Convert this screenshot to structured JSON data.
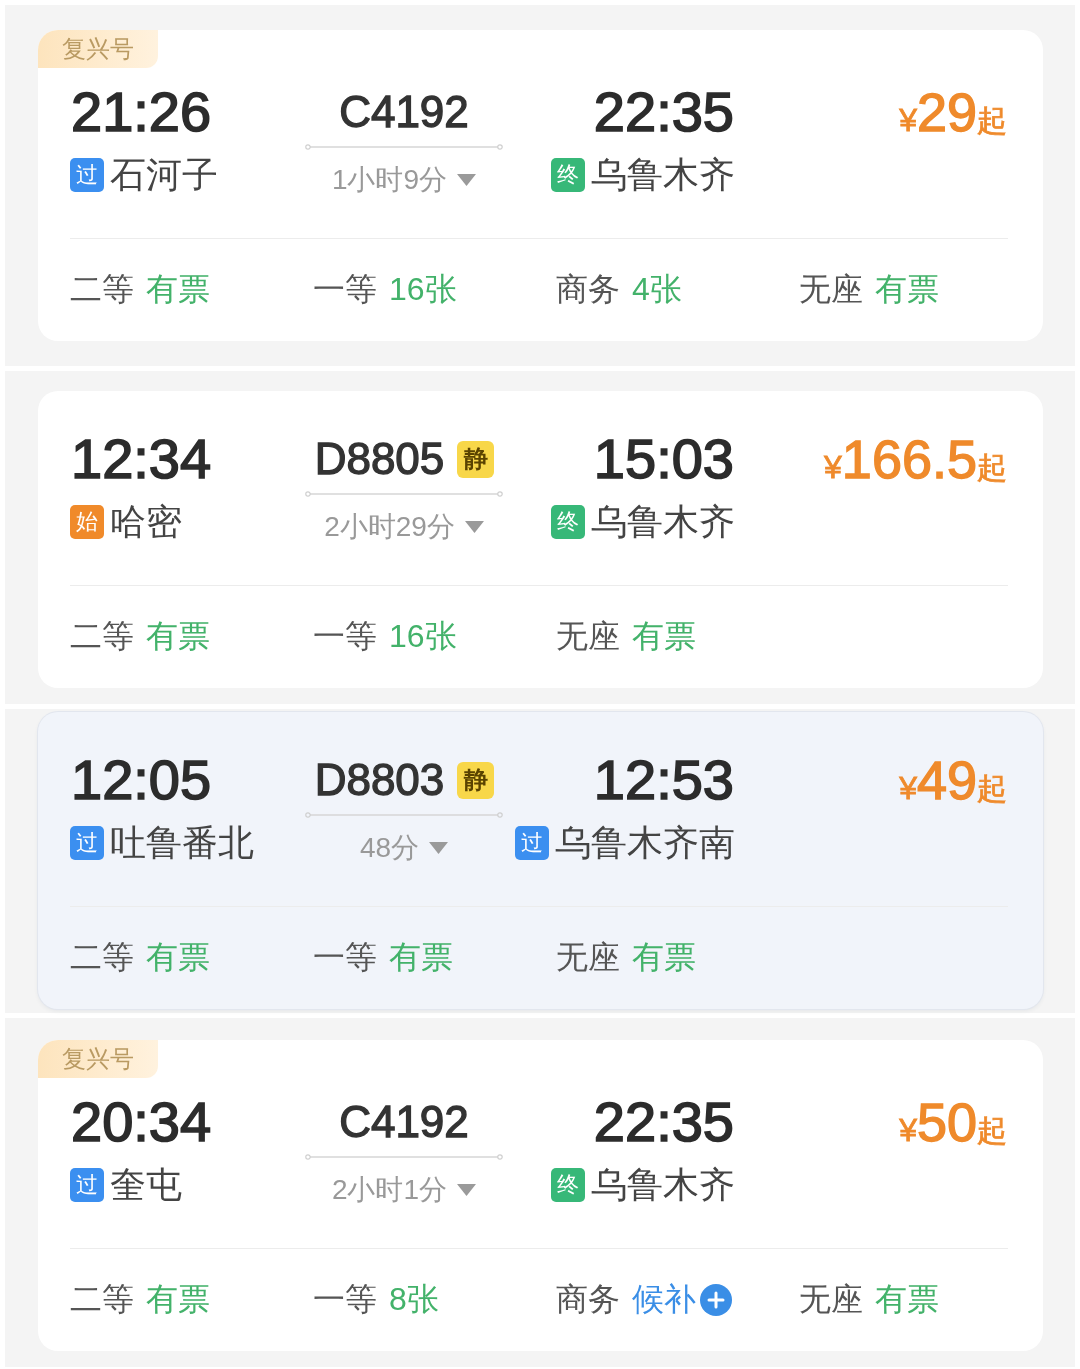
{
  "trains": [
    {
      "brand": "复兴号",
      "highlighted": false,
      "depart_time": "21:26",
      "depart_station": {
        "tag": "过",
        "kind": "pass",
        "name": "石河子"
      },
      "number": "C4192",
      "duration": "1小时9分",
      "arrive_time": "22:35",
      "arrive_station": {
        "tag": "终",
        "kind": "terminal",
        "name": "乌鲁木齐"
      },
      "price": {
        "currency": "¥",
        "amount": "29",
        "suffix": "起"
      },
      "seats": [
        {
          "class": "二等",
          "availability": "有票",
          "kind": "available"
        },
        {
          "class": "一等",
          "availability": "16张",
          "kind": "available"
        },
        {
          "class": "商务",
          "availability": "4张",
          "kind": "available"
        },
        {
          "class": "无座",
          "availability": "有票",
          "kind": "available"
        }
      ]
    },
    {
      "highlighted": false,
      "depart_time": "12:34",
      "depart_station": {
        "tag": "始",
        "kind": "origin",
        "name": "哈密"
      },
      "number": "D8805",
      "quiet_badge": "静",
      "duration": "2小时29分",
      "arrive_time": "15:03",
      "arrive_station": {
        "tag": "终",
        "kind": "terminal",
        "name": "乌鲁木齐"
      },
      "price": {
        "currency": "¥",
        "amount": "166.5",
        "suffix": "起"
      },
      "seats": [
        {
          "class": "二等",
          "availability": "有票",
          "kind": "available"
        },
        {
          "class": "一等",
          "availability": "16张",
          "kind": "available"
        },
        {
          "class": "无座",
          "availability": "有票",
          "kind": "available"
        }
      ]
    },
    {
      "highlighted": true,
      "depart_time": "12:05",
      "depart_station": {
        "tag": "过",
        "kind": "pass",
        "name": "吐鲁番北"
      },
      "number": "D8803",
      "quiet_badge": "静",
      "duration": "48分",
      "arrive_time": "12:53",
      "arrive_station": {
        "tag": "过",
        "kind": "pass",
        "name": "乌鲁木齐南"
      },
      "price": {
        "currency": "¥",
        "amount": "49",
        "suffix": "起"
      },
      "seats": [
        {
          "class": "二等",
          "availability": "有票",
          "kind": "available"
        },
        {
          "class": "一等",
          "availability": "有票",
          "kind": "available"
        },
        {
          "class": "无座",
          "availability": "有票",
          "kind": "available"
        }
      ]
    },
    {
      "brand": "复兴号",
      "highlighted": false,
      "depart_time": "20:34",
      "depart_station": {
        "tag": "过",
        "kind": "pass",
        "name": "奎屯"
      },
      "number": "C4192",
      "duration": "2小时1分",
      "arrive_time": "22:35",
      "arrive_station": {
        "tag": "终",
        "kind": "terminal",
        "name": "乌鲁木齐"
      },
      "price": {
        "currency": "¥",
        "amount": "50",
        "suffix": "起"
      },
      "seats": [
        {
          "class": "二等",
          "availability": "有票",
          "kind": "available"
        },
        {
          "class": "一等",
          "availability": "8张",
          "kind": "available"
        },
        {
          "class": "商务",
          "availability": "候补",
          "kind": "waitlist"
        },
        {
          "class": "无座",
          "availability": "有票",
          "kind": "available"
        }
      ]
    }
  ]
}
